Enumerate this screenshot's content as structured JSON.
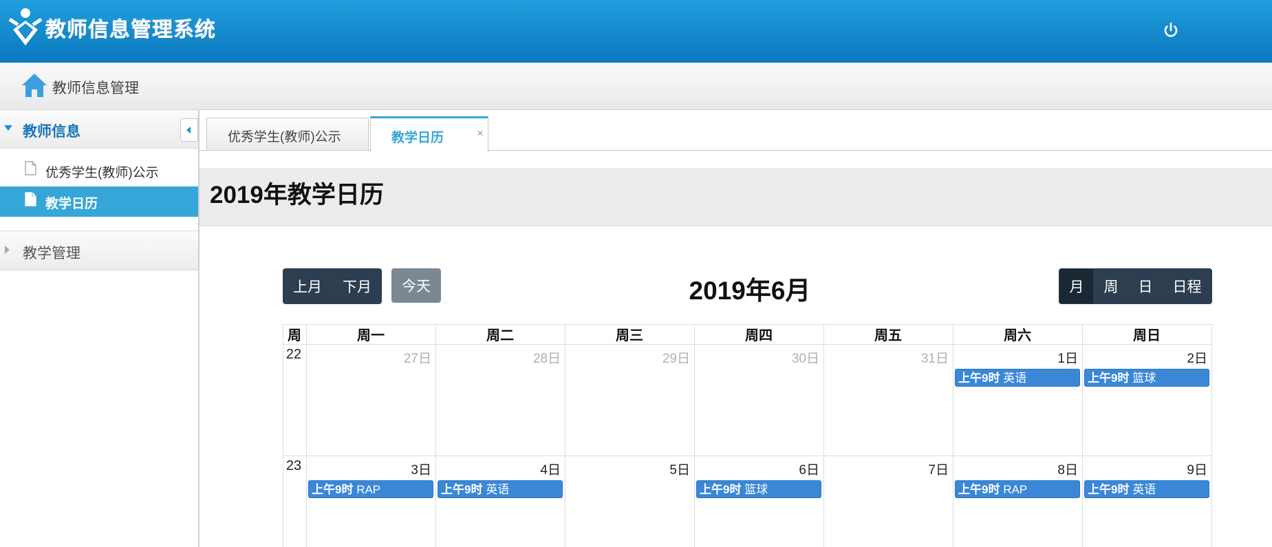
{
  "app": {
    "title": "教师信息管理系统"
  },
  "breadcrumb": {
    "label": "教师信息管理"
  },
  "sidebar": {
    "group1": {
      "label": "教师信息",
      "items": [
        {
          "label": "优秀学生(教师)公示"
        },
        {
          "label": "教学日历"
        }
      ]
    },
    "group2": {
      "label": "教学管理"
    }
  },
  "tabs": [
    {
      "label": "优秀学生(教师)公示"
    },
    {
      "label": "教学日历",
      "close": "×"
    }
  ],
  "page": {
    "title": "2019年教学日历"
  },
  "calendar": {
    "prev_label": "上月",
    "next_label": "下月",
    "today_label": "今天",
    "month_title": "2019年6月",
    "views": [
      "月",
      "周",
      "日",
      "日程"
    ],
    "active_view": "月",
    "week_header": "周",
    "day_headers": [
      "周一",
      "周二",
      "周三",
      "周四",
      "周五",
      "周六",
      "周日"
    ],
    "weeks": [
      {
        "week": "22",
        "days": [
          "27日",
          "28日",
          "29日",
          "30日",
          "31日",
          "1日",
          "2日"
        ],
        "other_month": [
          true,
          true,
          true,
          true,
          true,
          false,
          false
        ]
      },
      {
        "week": "23",
        "days": [
          "3日",
          "4日",
          "5日",
          "6日",
          "7日",
          "8日",
          "9日"
        ],
        "other_month": [
          false,
          false,
          false,
          false,
          false,
          false,
          false
        ]
      }
    ],
    "events": [
      {
        "week": 0,
        "day": 5,
        "time": "上午9时",
        "title": "英语"
      },
      {
        "week": 0,
        "day": 6,
        "time": "上午9时",
        "title": "篮球"
      },
      {
        "week": 1,
        "day": 0,
        "time": "上午9时",
        "title": "RAP"
      },
      {
        "week": 1,
        "day": 1,
        "time": "上午9时",
        "title": "英语"
      },
      {
        "week": 1,
        "day": 3,
        "time": "上午9时",
        "title": "篮球"
      },
      {
        "week": 1,
        "day": 5,
        "time": "上午9时",
        "title": "RAP"
      },
      {
        "week": 1,
        "day": 6,
        "time": "上午9时",
        "title": "英语"
      }
    ],
    "colors": {
      "event": "#3a87d8",
      "dark_button": "#2c3e50",
      "today_button": "#7b8894",
      "accent": "#36a6d8"
    }
  }
}
